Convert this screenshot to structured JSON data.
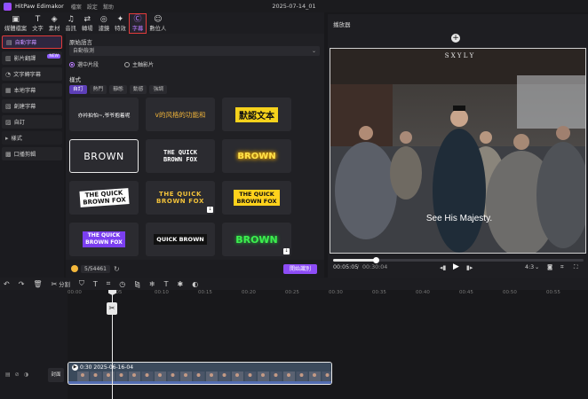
{
  "app": {
    "name": "HitPaw Edimakor",
    "menus": [
      "檔案",
      "設定",
      "幫助"
    ],
    "project_title": "2025-07-14_01"
  },
  "toolbar": {
    "items": [
      {
        "icon": "media-icon",
        "glyph": "▣",
        "label": "媒體檔案"
      },
      {
        "icon": "text-icon",
        "glyph": "T",
        "label": "文字"
      },
      {
        "icon": "material-icon",
        "glyph": "◈",
        "label": "素材"
      },
      {
        "icon": "music-icon",
        "glyph": "♫",
        "label": "音訊"
      },
      {
        "icon": "transition-icon",
        "glyph": "⇄",
        "label": "轉場"
      },
      {
        "icon": "filter-icon",
        "glyph": "◎",
        "label": "濾鏡"
      },
      {
        "icon": "effects-icon",
        "glyph": "✦",
        "label": "特效"
      },
      {
        "icon": "subtitle-icon",
        "glyph": "Ⓒ",
        "label": "字幕",
        "active": true
      },
      {
        "icon": "avatar-icon",
        "glyph": "☺",
        "label": "數位人"
      }
    ]
  },
  "sidenav": {
    "items": [
      {
        "icon": "auto-subtitle-icon",
        "glyph": "▤",
        "label": "自動字幕",
        "active": true
      },
      {
        "icon": "video-translate-icon",
        "glyph": "▥",
        "label": "影片翻譯",
        "badge": "NEW"
      },
      {
        "icon": "text-to-speech-icon",
        "glyph": "◔",
        "label": "文字轉字幕"
      },
      {
        "icon": "local-subtitle-icon",
        "glyph": "▦",
        "label": "本地字幕"
      },
      {
        "icon": "create-subtitle-icon",
        "glyph": "▧",
        "label": "創建字幕"
      },
      {
        "icon": "custom-icon",
        "glyph": "▨",
        "label": "自訂"
      },
      {
        "icon": "style-icon",
        "glyph": "▸",
        "label": "樣式",
        "group": true
      },
      {
        "icon": "oral-cut-icon",
        "glyph": "▩",
        "label": "口播剪輯"
      }
    ]
  },
  "panel": {
    "source_lang_label": "原始語言",
    "source_lang_value": "自動檢測",
    "radio_selected": "選中片段",
    "radio_main": "主軸影片",
    "style_label": "樣式",
    "style_tabs": [
      {
        "label": "自訂",
        "active": true
      },
      {
        "label": "熱門"
      },
      {
        "label": "靜態"
      },
      {
        "label": "動感"
      },
      {
        "label": "強調"
      }
    ],
    "cards": [
      {
        "cls": "s1",
        "text": "亦衿拍怕~,爷爷抱着呢"
      },
      {
        "cls": "s2",
        "text": "v的风格的功能和"
      },
      {
        "cls": "s3",
        "text": "默認文本"
      },
      {
        "cls": "s4",
        "text": "BROWN",
        "selected": true
      },
      {
        "cls": "s5",
        "text": "THE QUICK\nBROWN FOX"
      },
      {
        "cls": "s6",
        "text": "BROWN"
      },
      {
        "cls": "s7",
        "text": "THE QUICK\nBROWN FOX"
      },
      {
        "cls": "s8",
        "text": "THE QUICK\nBROWN FOX",
        "download": true
      },
      {
        "cls": "s9",
        "text": "THE QUICK\nBROWN FOX"
      },
      {
        "cls": "s10",
        "text": "THE QUICK\nBROWN FOX"
      },
      {
        "cls": "s11",
        "text": "QUICK BROWN"
      },
      {
        "cls": "s12",
        "text": "BROWN",
        "download": true
      }
    ],
    "credits": "5/54461",
    "start_button": "開始識別"
  },
  "player": {
    "title": "播放器",
    "top_letters": "S   X   Y   L   Y",
    "subtitle": "See His Majesty.",
    "current_time": "00:05:05",
    "separator": "/",
    "total_time": "00:30:04",
    "aspect": "4:3",
    "progress": 0.17
  },
  "timeline_tools": [
    {
      "icon": "undo-icon",
      "glyph": "↶"
    },
    {
      "icon": "redo-icon",
      "glyph": "↷"
    },
    {
      "icon": "delete-icon",
      "glyph": "🗑"
    },
    {
      "icon": "split-icon",
      "glyph": "✂",
      "label": "分割"
    },
    {
      "icon": "shield-icon",
      "glyph": "⛉"
    },
    {
      "icon": "text-tool-icon",
      "glyph": "T"
    },
    {
      "icon": "crop-icon",
      "glyph": "⌗"
    },
    {
      "icon": "speed-icon",
      "glyph": "◷"
    },
    {
      "icon": "mirror-icon",
      "glyph": "⧎"
    },
    {
      "icon": "freeze-icon",
      "glyph": "❄"
    },
    {
      "icon": "text-t-icon",
      "glyph": "T"
    },
    {
      "icon": "ai-icon",
      "glyph": "✱"
    },
    {
      "icon": "color-icon",
      "glyph": "◐"
    }
  ],
  "ruler": [
    "00:00",
    "0:05",
    "00:10",
    "00:15",
    "00:20",
    "00:25",
    "00:30",
    "00:35",
    "00:40",
    "00:45",
    "00:50",
    "00:55"
  ],
  "track": {
    "cover_label": "封面",
    "clip_label": "0:30 2025-06-16-04"
  },
  "colors": {
    "accent": "#8d4cf6",
    "highlight_border": "#e23b3b"
  }
}
